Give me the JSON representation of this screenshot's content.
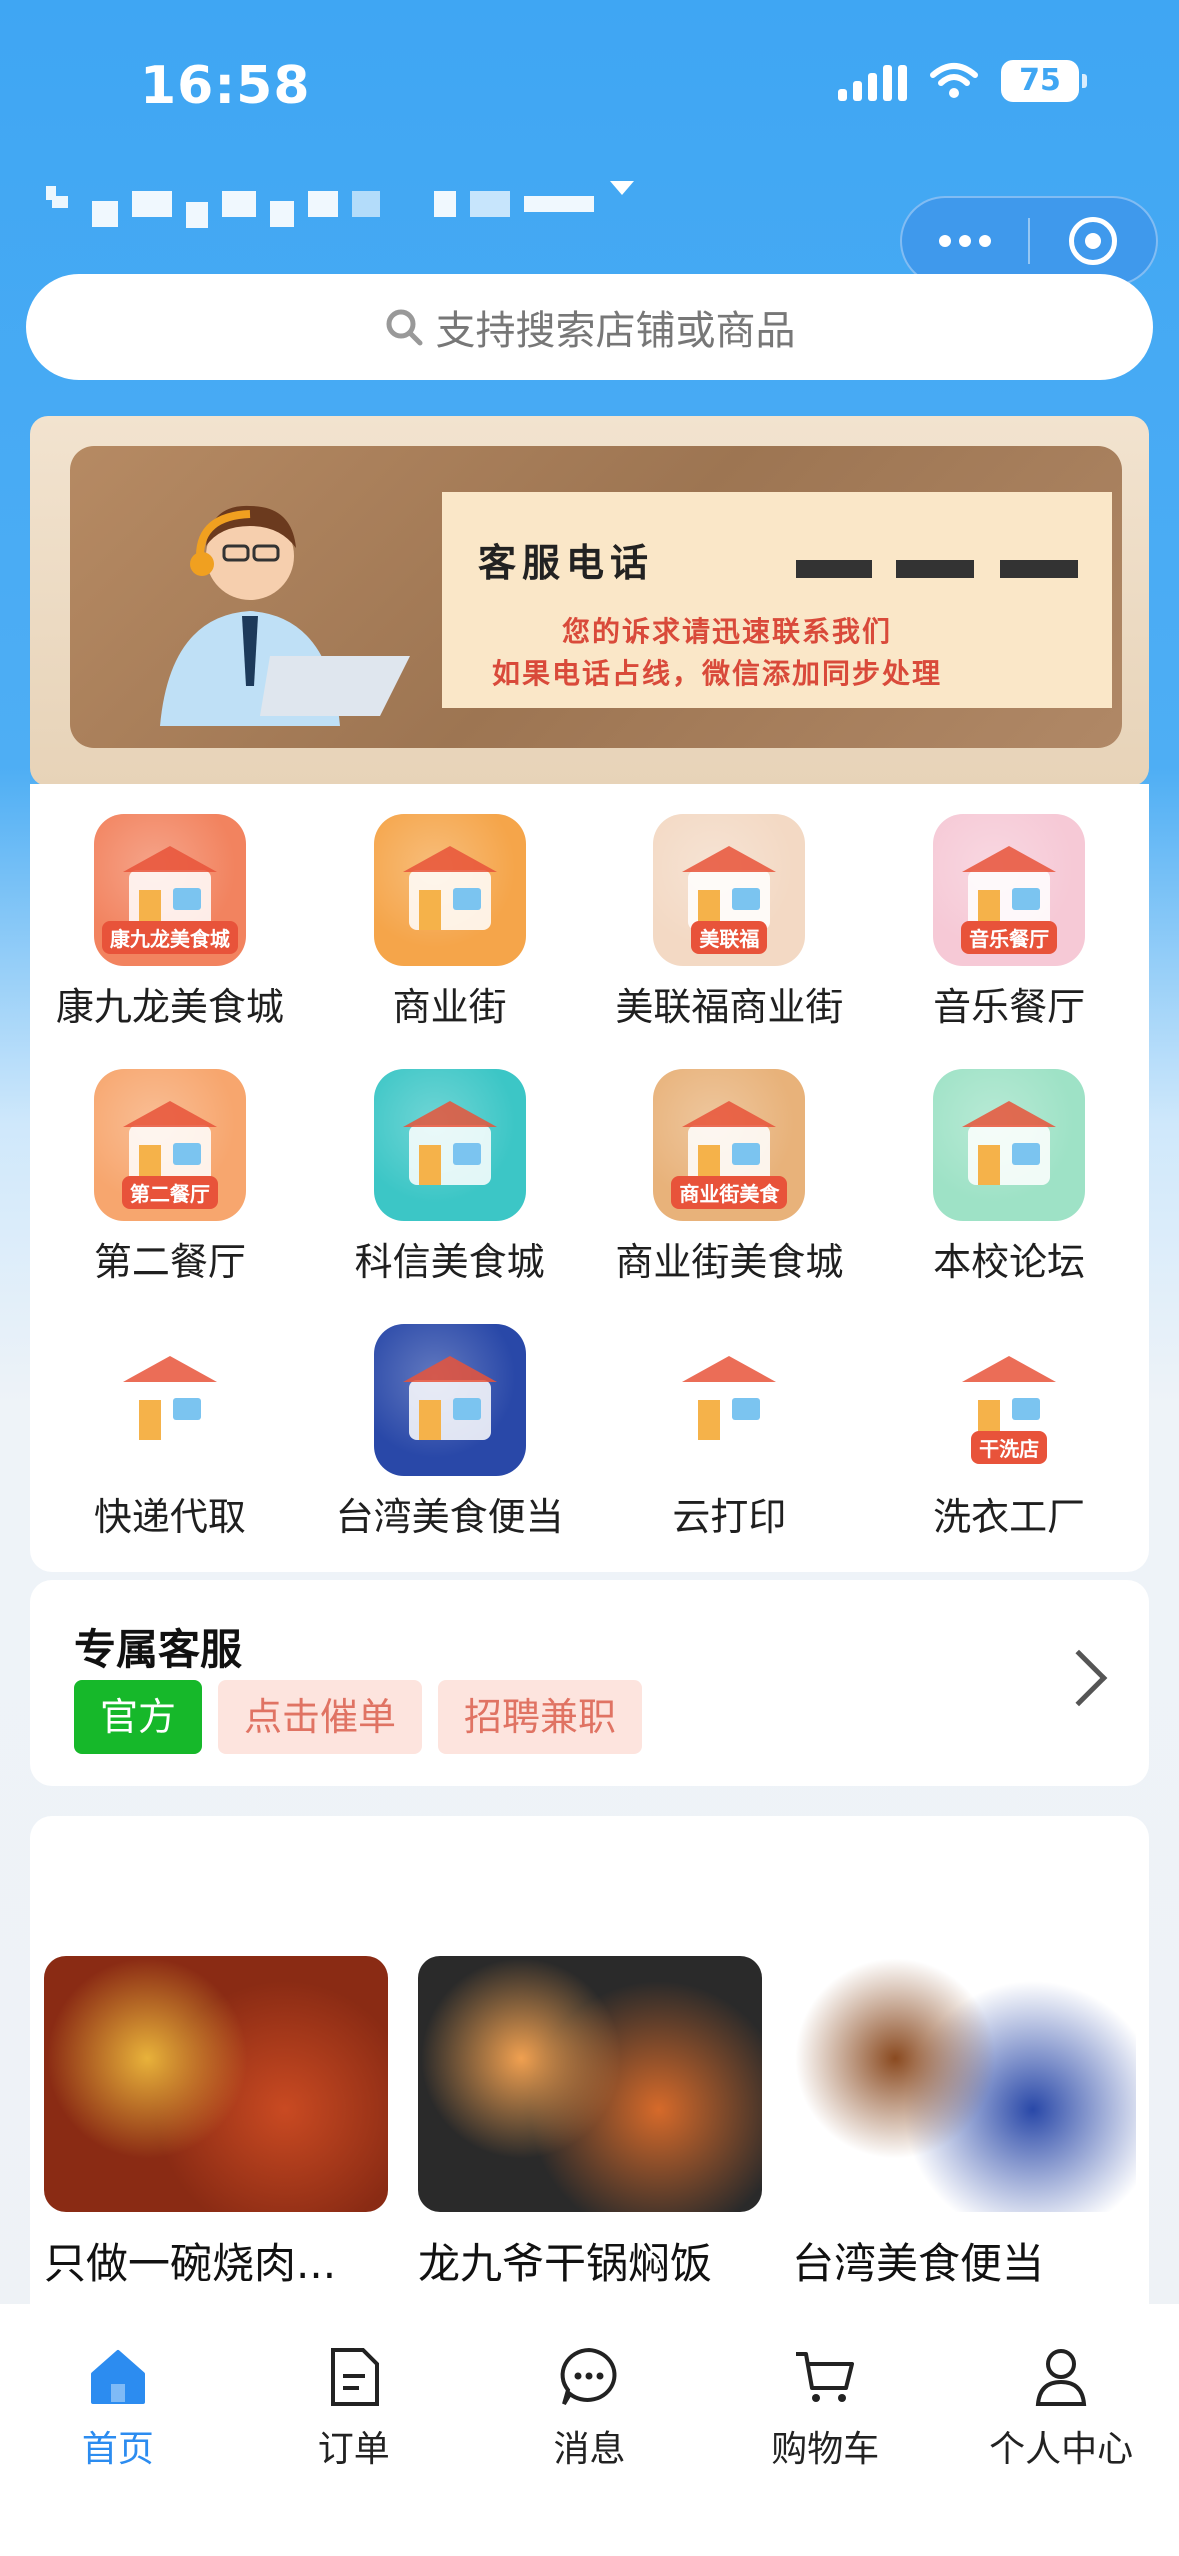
{
  "status_bar": {
    "time": "16:58",
    "battery": "75"
  },
  "search": {
    "placeholder": "支持搜索店铺或商品"
  },
  "banner": {
    "title": "客服电话",
    "line1": "您的诉求请迅速联系我们",
    "line2": "如果电话占线，微信添加同步处理"
  },
  "grid": [
    {
      "label": "康九龙美食城",
      "icon": "food-court-icon",
      "badge": "康九龙美食城",
      "color": "#f2835f"
    },
    {
      "label": "商业街",
      "icon": "shop-street-icon",
      "badge": "",
      "color": "#f5a54a"
    },
    {
      "label": "美联福商业街",
      "icon": "store-icon",
      "badge": "美联福",
      "color": "#f3d9c4"
    },
    {
      "label": "音乐餐厅",
      "icon": "music-restaurant-icon",
      "badge": "音乐餐厅",
      "color": "#f6c9d6"
    },
    {
      "label": "第二餐厅",
      "icon": "second-restaurant-icon",
      "badge": "第二餐厅",
      "color": "#f7a66e"
    },
    {
      "label": "科信美食城",
      "icon": "building-icon",
      "badge": "",
      "color": "#3cc6c6"
    },
    {
      "label": "商业街美食城",
      "icon": "noodle-bowl-icon",
      "badge": "商业街美食",
      "color": "#e8b27a"
    },
    {
      "label": "本校论坛",
      "icon": "school-board-icon",
      "badge": "",
      "color": "#9ee2c6"
    },
    {
      "label": "快递代取",
      "icon": "package-icon",
      "badge": "",
      "color": "#ffffff"
    },
    {
      "label": "台湾美食便当",
      "icon": "bento-poster-icon",
      "badge": "",
      "color": "#2948a8"
    },
    {
      "label": "云打印",
      "icon": "cloud-print-icon",
      "badge": "",
      "color": "#ffffff"
    },
    {
      "label": "洗衣工厂",
      "icon": "laundry-icon",
      "badge": "干洗店",
      "color": "#ffffff"
    }
  ],
  "service": {
    "title": "专属客服",
    "tags": [
      "官方",
      "点击催单",
      "招聘兼职"
    ]
  },
  "food": [
    {
      "name": "只做一碗烧肉...",
      "colors": [
        "#8a2b14",
        "#c94a22",
        "#e8b23a"
      ]
    },
    {
      "name": "龙九爷干锅焖饭",
      "colors": [
        "#2a2a2a",
        "#d66a2a",
        "#f0a050"
      ]
    },
    {
      "name": "台湾美食便当",
      "colors": [
        "#ffffff",
        "#2948a8",
        "#8a4a20"
      ]
    }
  ],
  "tabbar": [
    {
      "label": "首页",
      "icon": "home-icon",
      "active": true
    },
    {
      "label": "订单",
      "icon": "order-icon",
      "active": false
    },
    {
      "label": "消息",
      "icon": "message-icon",
      "active": false
    },
    {
      "label": "购物车",
      "icon": "cart-icon",
      "active": false
    },
    {
      "label": "个人中心",
      "icon": "profile-icon",
      "active": false
    }
  ]
}
